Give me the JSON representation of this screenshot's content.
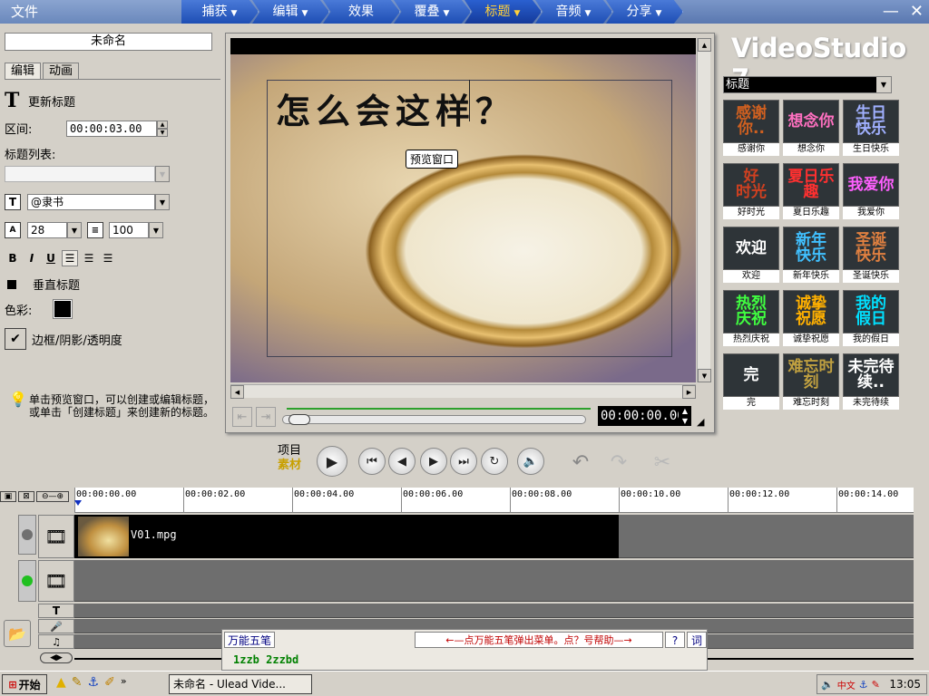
{
  "menu": {
    "file": "文件",
    "steps": [
      {
        "label": "捕获",
        "arrow": "▼",
        "active": false
      },
      {
        "label": "编辑",
        "arrow": "▼",
        "active": false
      },
      {
        "label": "效果",
        "arrow": "",
        "active": false
      },
      {
        "label": "覆叠",
        "arrow": "▼",
        "active": false
      },
      {
        "label": "标题",
        "arrow": "▼",
        "active": true
      },
      {
        "label": "音频",
        "arrow": "▼",
        "active": false
      },
      {
        "label": "分享",
        "arrow": "▼",
        "active": false
      }
    ],
    "minimize": "—",
    "close": "✕"
  },
  "left": {
    "project_name": "未命名",
    "tabs": [
      "编辑",
      "动画"
    ],
    "update_title": "更新标题",
    "duration_label": "区间:",
    "duration_value": "00:00:03.00",
    "title_list_label": "标题列表:",
    "font_value": "@隶书",
    "font_size": "28",
    "line_spacing": "100",
    "fmt": {
      "bold": "B",
      "italic": "I",
      "underline": "U"
    },
    "vertical_label": "垂直标题",
    "color_label": "色彩:",
    "border_label": "边框/阴影/透明度",
    "hint": "单击预览窗口，可以创建或编辑标题，或单击「创建标题」来创建新的标题。"
  },
  "preview": {
    "title_text": "怎么会这样？",
    "tooltip": "预览窗口",
    "timecode": "00:00:00.00"
  },
  "playback": {
    "project": "项目",
    "clip": "素材"
  },
  "library": {
    "logo": "VideoStudio 7",
    "category": "标题",
    "items": [
      {
        "art": "感谢\n你..",
        "label": "感谢你",
        "color": "#d06020"
      },
      {
        "art": "想念你",
        "label": "想念你",
        "color": "#ff70c0"
      },
      {
        "art": "生日\n快乐",
        "label": "生日快乐",
        "color": "#a0b0ff"
      },
      {
        "art": "好\n时光",
        "label": "好时光",
        "color": "#d04020"
      },
      {
        "art": "夏日乐趣",
        "label": "夏日乐趣",
        "color": "#ff3030"
      },
      {
        "art": "我爱你",
        "label": "我爱你",
        "color": "#ff60ff"
      },
      {
        "art": "欢迎",
        "label": "欢迎",
        "color": "#ffffff"
      },
      {
        "art": "新年\n快乐",
        "label": "新年快乐",
        "color": "#40c0ff"
      },
      {
        "art": "圣诞\n快乐",
        "label": "圣诞快乐",
        "color": "#e08040"
      },
      {
        "art": "热烈\n庆祝",
        "label": "热烈庆祝",
        "color": "#40ff40"
      },
      {
        "art": "诚挚\n祝愿",
        "label": "诚挚祝愿",
        "color": "#ffb000"
      },
      {
        "art": "我的\n假日",
        "label": "我的假日",
        "color": "#00e0ff"
      },
      {
        "art": "完",
        "label": "完",
        "color": "#ffffff"
      },
      {
        "art": "难忘时刻",
        "label": "难忘时刻",
        "color": "#c0a040"
      },
      {
        "art": "未完待续..",
        "label": "未完待续",
        "color": "#ffffff"
      }
    ]
  },
  "timeline": {
    "ticks": [
      "00:00:00.00",
      "00:00:02.00",
      "00:00:04.00",
      "00:00:06.00",
      "00:00:08.00",
      "00:00:10.00",
      "00:00:12.00",
      "00:00:14.00"
    ],
    "clip_name": "V01.mpg"
  },
  "ime": {
    "name": "万能五笔",
    "help": "←—点万能五笔弹出菜单。点？号帮助—→",
    "help_btn": "?",
    "word_btn": "词",
    "input": "1zzb 2zzbd"
  },
  "taskbar": {
    "start": "开始",
    "task": "未命名 - Ulead Vide...",
    "lang": "中文",
    "clock": "13:05"
  }
}
